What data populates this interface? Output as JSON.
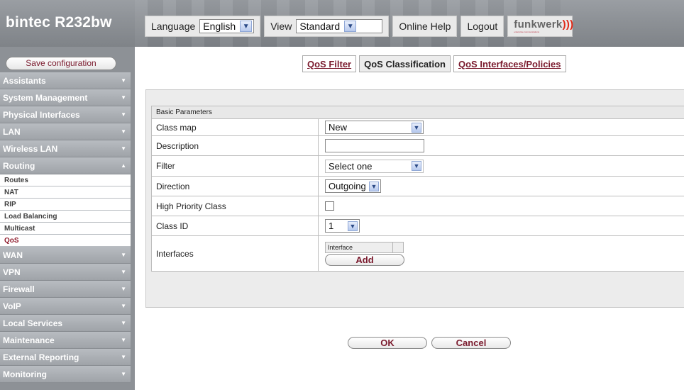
{
  "header": {
    "brand": "bintec R232bw",
    "language_label": "Language",
    "language_value": "English",
    "view_label": "View",
    "view_value": "Standard",
    "online_help": "Online Help",
    "logout": "Logout",
    "logo_text": "funkwerk",
    "logo_wave": ")))",
    "logo_tagline": "enterprise communications"
  },
  "sidebar": {
    "save_label": "Save configuration",
    "items_top": [
      {
        "label": "Assistants",
        "chevron": "▼"
      },
      {
        "label": "System Management",
        "chevron": "▼"
      },
      {
        "label": "Physical Interfaces",
        "chevron": "▼"
      },
      {
        "label": "LAN",
        "chevron": "▼"
      },
      {
        "label": "Wireless LAN",
        "chevron": "▼"
      }
    ],
    "routing": {
      "label": "Routing",
      "chevron": "▲"
    },
    "routing_subitems": [
      "Routes",
      "NAT",
      "RIP",
      "Load Balancing",
      "Multicast",
      "QoS"
    ],
    "items_bottom": [
      {
        "label": "WAN",
        "chevron": "▼"
      },
      {
        "label": "VPN",
        "chevron": "▼"
      },
      {
        "label": "Firewall",
        "chevron": "▼"
      },
      {
        "label": "VoIP",
        "chevron": "▼"
      },
      {
        "label": "Local Services",
        "chevron": "▼"
      },
      {
        "label": "Maintenance",
        "chevron": "▼"
      },
      {
        "label": "External Reporting",
        "chevron": "▼"
      },
      {
        "label": "Monitoring",
        "chevron": "▼"
      }
    ]
  },
  "tabs": {
    "filter": "QoS Filter",
    "classification": "QoS Classification",
    "interfaces": "QoS Interfaces/Policies"
  },
  "form": {
    "section": "Basic Parameters",
    "class_map_label": "Class map",
    "class_map_value": "New",
    "description_label": "Description",
    "description_value": "",
    "filter_label": "Filter",
    "filter_value": "Select one",
    "direction_label": "Direction",
    "direction_value": "Outgoing",
    "high_priority_label": "High Priority Class",
    "class_id_label": "Class ID",
    "class_id_value": "1",
    "interfaces_label": "Interfaces",
    "interface_col": "Interface",
    "add_label": "Add"
  },
  "actions": {
    "ok": "OK",
    "cancel": "Cancel"
  }
}
